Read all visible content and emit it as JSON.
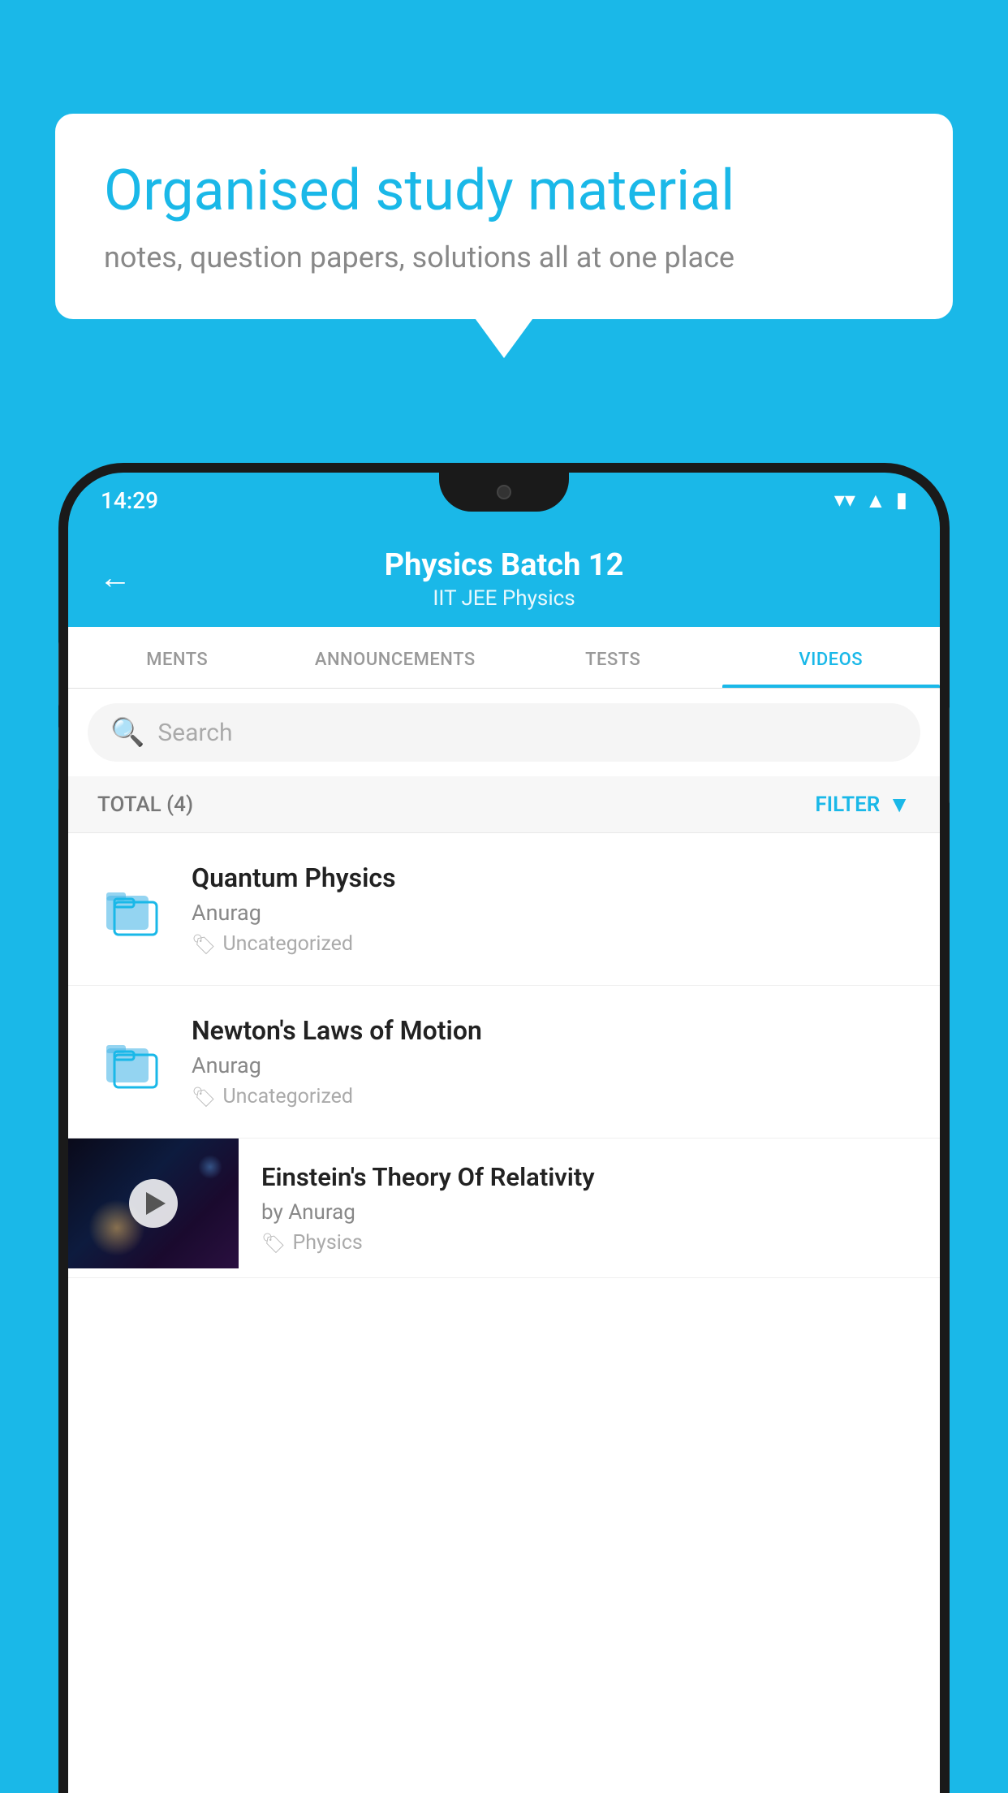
{
  "background_color": "#1ab8e8",
  "speech_bubble": {
    "title": "Organised study material",
    "subtitle": "notes, question papers, solutions all at one place"
  },
  "phone": {
    "status_bar": {
      "time": "14:29",
      "wifi_icon": "▼",
      "signal_icon": "▲",
      "battery_icon": "▮"
    },
    "header": {
      "back_label": "←",
      "title": "Physics Batch 12",
      "subtitle": "IIT JEE   Physics"
    },
    "tabs": [
      {
        "label": "MENTS",
        "active": false
      },
      {
        "label": "ANNOUNCEMENTS",
        "active": false
      },
      {
        "label": "TESTS",
        "active": false
      },
      {
        "label": "VIDEOS",
        "active": true
      }
    ],
    "search": {
      "placeholder": "Search"
    },
    "filter_bar": {
      "total_label": "TOTAL (4)",
      "filter_label": "FILTER"
    },
    "videos": [
      {
        "id": 1,
        "title": "Quantum Physics",
        "author": "Anurag",
        "tag": "Uncategorized",
        "has_thumbnail": false
      },
      {
        "id": 2,
        "title": "Newton's Laws of Motion",
        "author": "Anurag",
        "tag": "Uncategorized",
        "has_thumbnail": false
      },
      {
        "id": 3,
        "title": "Einstein's Theory Of Relativity",
        "author": "by Anurag",
        "tag": "Physics",
        "has_thumbnail": true
      }
    ]
  }
}
